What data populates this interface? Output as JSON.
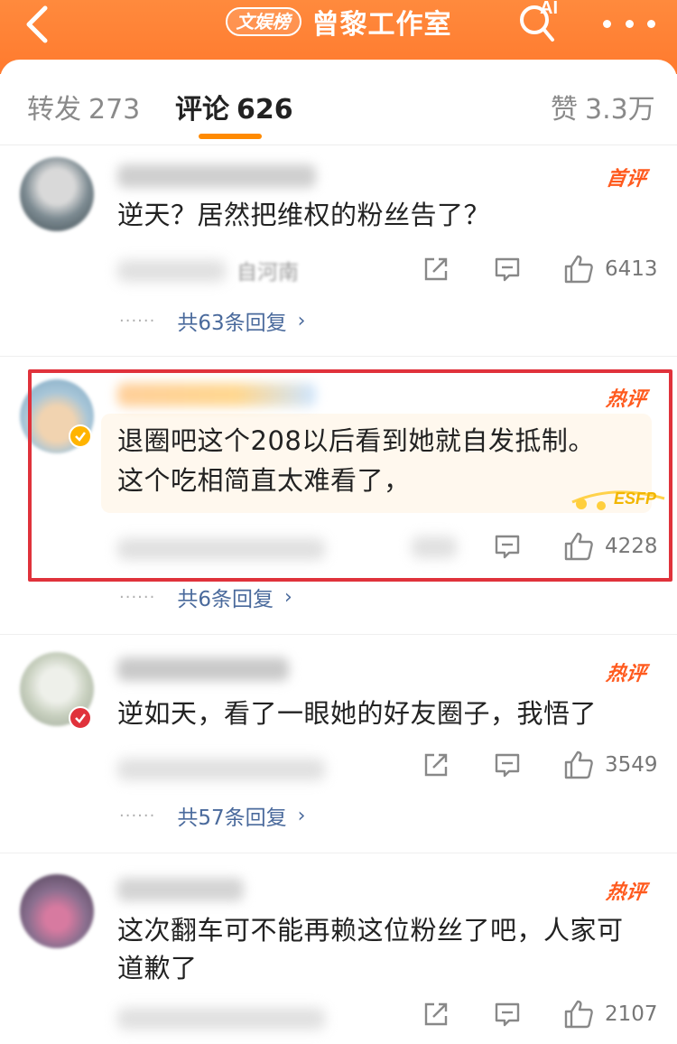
{
  "header": {
    "badge": "文娱榜",
    "title": "曾黎工作室",
    "ai_label": "AI"
  },
  "tabs": [
    {
      "label": "转发",
      "count": "273"
    },
    {
      "label": "评论",
      "count": "626"
    },
    {
      "label": "赞",
      "count": "3.3万"
    }
  ],
  "comments": [
    {
      "tag": "首评",
      "text": "逆天？居然把维权的粉丝告了？",
      "meta_visible": "自河南",
      "likes": "6413",
      "replies": "共63条回复"
    },
    {
      "tag": "热评",
      "text_line1": "退圈吧这个208以后看到她就自发抵制。",
      "text_line2": "这个吃相简直太难看了，",
      "likes": "4228",
      "replies": "共6条回复",
      "badge": "ESFP"
    },
    {
      "tag": "热评",
      "text": "逆如天，看了一眼她的好友圈子，我悟了",
      "likes": "3549",
      "replies": "共57条回复"
    },
    {
      "tag": "热评",
      "text_line1": "这次翻车可不能再赖这位粉丝了吧，人家可",
      "text_line2": "道歉了",
      "likes": "2107"
    }
  ],
  "colors": {
    "header_orange": "#ff7a2e",
    "tab_indicator": "#ff8a00",
    "tag_red": "#ff5a1e",
    "reply_blue": "#4a6a9c",
    "highlight_red": "#e0323b"
  },
  "icons": [
    "back-arrow-icon",
    "ai-search-icon",
    "more-icon",
    "share-icon",
    "comment-icon",
    "thumbs-up-icon",
    "chevron-right-icon",
    "verified-icon"
  ]
}
